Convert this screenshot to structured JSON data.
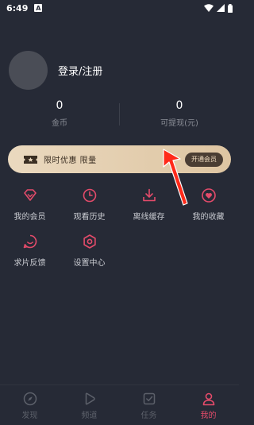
{
  "status_bar": {
    "time": "6:49",
    "notification_letter": "A"
  },
  "profile": {
    "login_label": "登录/注册"
  },
  "stats": [
    {
      "value": "0",
      "label": "金币"
    },
    {
      "value": "0",
      "label": "可提现(元)"
    }
  ],
  "vip_banner": {
    "text": "限时优惠 限量",
    "button_label": "开通会员"
  },
  "menu_row1": [
    {
      "label": "我的会员",
      "icon": "diamond-icon"
    },
    {
      "label": "观看历史",
      "icon": "clock-icon"
    },
    {
      "label": "离线缓存",
      "icon": "download-icon"
    },
    {
      "label": "我的收藏",
      "icon": "heart-icon"
    }
  ],
  "menu_row2": [
    {
      "label": "求片反馈",
      "icon": "smile-icon"
    },
    {
      "label": "设置中心",
      "icon": "settings-icon"
    }
  ],
  "bottom_nav": [
    {
      "label": "发现",
      "icon": "compass-icon",
      "active": false
    },
    {
      "label": "频道",
      "icon": "play-icon",
      "active": false
    },
    {
      "label": "任务",
      "icon": "task-icon",
      "active": false
    },
    {
      "label": "我的",
      "icon": "user-icon",
      "active": true
    }
  ],
  "colors": {
    "background": "#262a36",
    "accent": "#e34b6a",
    "vip_gold": "#e6d3b6",
    "annotation_arrow": "#ff2a1a"
  }
}
